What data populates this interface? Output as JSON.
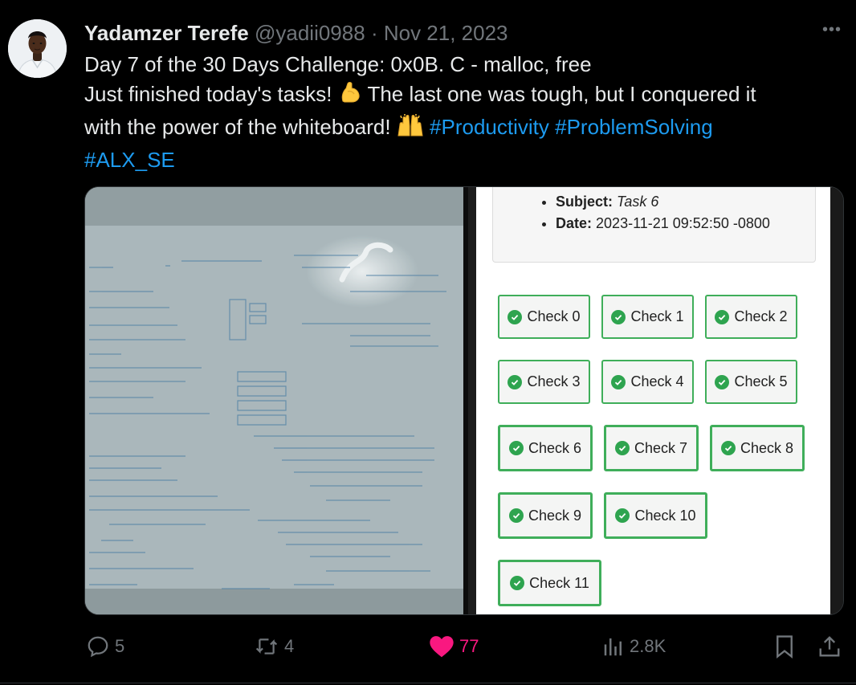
{
  "author": {
    "name": "Yadamzer Terefe",
    "handle": "@yadii0988",
    "separator": "·",
    "date": "Nov 21, 2023"
  },
  "more_label": "•••",
  "tweet": {
    "line1": "Day 7 of the 30 Days Challenge: 0x0B. C - malloc, free",
    "line2a": "Just finished today's tasks!",
    "line2_emoji": "💪",
    "line2b": "The last one was tough, but I conquered it",
    "line3a": "with the power of the whiteboard!",
    "line3_emoji": "🙌",
    "hashtags": [
      "#Productivity",
      "#ProblemSolving",
      "#ALX_SE"
    ]
  },
  "screenshot": {
    "subject_label": "Subject:",
    "subject_value": "Task 6",
    "date_label": "Date:",
    "date_value": "2023-11-21 09:52:50 -0800",
    "checks": [
      "Check 0",
      "Check 1",
      "Check 2",
      "Check 3",
      "Check 4",
      "Check 5",
      "Check 6",
      "Check 7",
      "Check 8",
      "Check 9",
      "Check 10",
      "Check 11"
    ]
  },
  "actions": {
    "replies": "5",
    "reposts": "4",
    "likes": "77",
    "views": "2.8K"
  },
  "colors": {
    "accent": "#1d9bf0",
    "like": "#f91880",
    "check_green": "#2ea44f"
  }
}
